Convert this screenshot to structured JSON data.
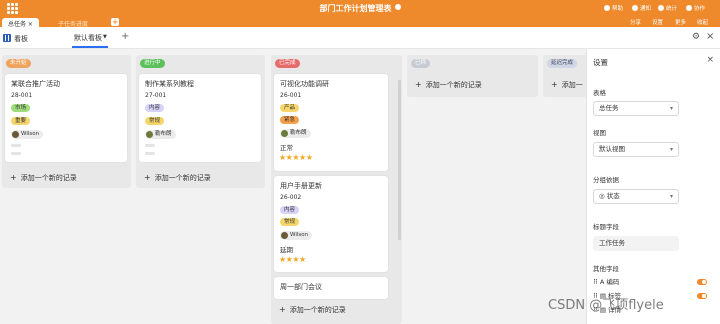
{
  "app": {
    "title": "部门工作计划管理表",
    "topbar_right": [
      "帮助",
      "通知",
      "统计",
      "协作"
    ],
    "accent": "#ef8a2c"
  },
  "tabs": [
    {
      "label": "总任务",
      "active": true
    },
    {
      "label": "子任务进度",
      "active": false
    }
  ],
  "tabs_right": [
    "分享",
    "设置",
    "更多",
    "收起"
  ],
  "viewbar": {
    "kanban_label": "看板",
    "view_tab": "默认看板"
  },
  "columns": [
    {
      "status": "未开始",
      "color": "#f0a35c",
      "add_label": "添加一个新的记录",
      "cards": [
        {
          "title": "某联合推广活动",
          "id": "28-001",
          "tags": [
            {
              "label": "市场",
              "bg": "#9fdc7c"
            },
            {
              "label": "重要",
              "bg": "#f6d66a"
            }
          ],
          "person": "Wilson"
        }
      ]
    },
    {
      "status": "进行中",
      "color": "#5cc15c",
      "add_label": "添加一个新的记录",
      "cards": [
        {
          "title": "制作某系列教程",
          "id": "27-001",
          "tags": [
            {
              "label": "内容",
              "bg": "#d7d2f7"
            },
            {
              "label": "常规",
              "bg": "#f6d66a"
            }
          ],
          "person": "勒布朗"
        }
      ]
    },
    {
      "status": "已完成",
      "color": "#e86b6b",
      "add_label": "添加一个新的记录",
      "cards": [
        {
          "title": "可视化功能调研",
          "id": "26-001",
          "tags": [
            {
              "label": "产品",
              "bg": "#f6d66a"
            },
            {
              "label": "紧急",
              "bg": "#f5a04a"
            }
          ],
          "person": "勒布朗",
          "status_text": "正常",
          "stars": "★★★★★"
        },
        {
          "title": "用户手册更新",
          "id": "26-002",
          "tags": [
            {
              "label": "内容",
              "bg": "#d7d2f7"
            },
            {
              "label": "常规",
              "bg": "#f6d66a"
            }
          ],
          "person": "Wilson",
          "status_text": "延期",
          "stars": "★★★★"
        },
        {
          "title": "周一部门会议"
        }
      ]
    },
    {
      "status": "已称",
      "color": "#c7cbd3",
      "add_label": "添加一个新的记录",
      "cards": []
    },
    {
      "status": "延迟完成",
      "color": "#cfd7e6",
      "add_label": "添加一",
      "cards": []
    }
  ],
  "settings": {
    "title": "设置",
    "table_label": "表格",
    "table_value": "总任务",
    "view_label": "视图",
    "view_value": "默认视图",
    "group_label": "分组依据",
    "group_value": "状态",
    "title_field_label": "标题字段",
    "title_field_value": "工作任务",
    "other_fields_label": "其他字段",
    "fields": [
      "编码",
      "标签",
      "详情"
    ]
  },
  "watermark": "CSDN @飞项flyele"
}
